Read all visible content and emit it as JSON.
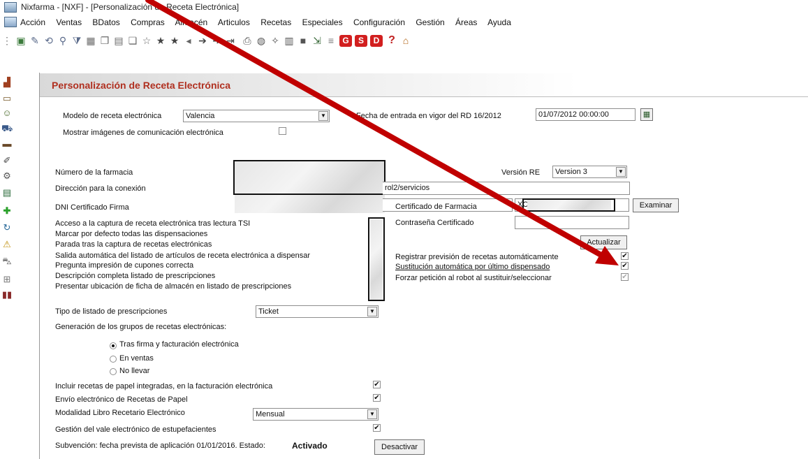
{
  "window": {
    "title": "Nixfarma - [NXF] - [Personalización de Receta Electrónica]"
  },
  "menu": [
    "Acción",
    "Ventas",
    "BDatos",
    "Compras",
    "Almacén",
    "Articulos",
    "Recetas",
    "Especiales",
    "Configuración",
    "Gestión",
    "Áreas",
    "Ayuda"
  ],
  "toolbar": {
    "g_label": "G",
    "s_label": "S",
    "d_label": "D",
    "help_label": "?"
  },
  "page": {
    "title": "Personalización de Receta Electrónica"
  },
  "form": {
    "modelo_label": "Modelo de receta electrónica",
    "modelo_value": "Valencia",
    "fecha_label": "Fecha de entrada en vigor del RD 16/2012",
    "fecha_value": "01/07/2012 00:00:00",
    "mostrar_label": "Mostrar imágenes de comunicación electrónica",
    "numero_label": "Número de la farmacia",
    "version_label": "Versión RE",
    "version_value": "Version 3",
    "direccion_label": "Dirección para la conexión",
    "direccion_value": "rol2/servicios",
    "dni_label": "DNI Certificado Firma",
    "certificado_label": "Certificado de Farmacia",
    "certificado_value": "XC",
    "examinar_label": "Examinar",
    "contrasena_label": "Contraseña Certificado",
    "actualizar_label": "Actualizar",
    "options_left": [
      "Acceso a la captura de receta electrónica tras lectura TSI",
      "Marcar por defecto todas las dispensaciones",
      "Parada tras la captura de recetas electrónicas",
      "Salida automática del listado de artículos de receta electrónica a dispensar",
      "Pregunta impresión de cupones correcta",
      "Descripción completa listado de prescripciones",
      "Presentar ubicación de ficha de almacén en listado de prescripciones"
    ],
    "options_right": [
      {
        "label": "Registrar previsión de recetas automáticamente",
        "checked": true
      },
      {
        "label": "Sustitución automática por último dispensado",
        "checked": true
      },
      {
        "label": "Forzar petición al robot al sustituir/seleccionar",
        "checked": true
      }
    ],
    "tipo_label": "Tipo de listado de prescripciones",
    "tipo_value": "Ticket",
    "generacion_label": "Generación de los grupos de recetas electrónicas:",
    "radios": [
      {
        "label": "Tras firma y facturación electrónica",
        "selected": true
      },
      {
        "label": "En ventas",
        "selected": false
      },
      {
        "label": "No llevar",
        "selected": false
      }
    ],
    "incluir_label": "Incluir recetas de papel integradas, en la facturación electrónica",
    "envio_label": "Envío electrónico de Recetas de Papel",
    "modalidad_label": "Modalidad Libro Recetario Electrónico",
    "modalidad_value": "Mensual",
    "gestion_label": "Gestión del vale electrónico de estupefacientes",
    "subvencion_text": "Subvención: fecha prevista de aplicación 01/01/2016. Estado:",
    "estado_value": "Activado",
    "desactivar_label": "Desactivar"
  },
  "colors": {
    "accent_title": "#b03020",
    "arrow": "#c00000"
  }
}
